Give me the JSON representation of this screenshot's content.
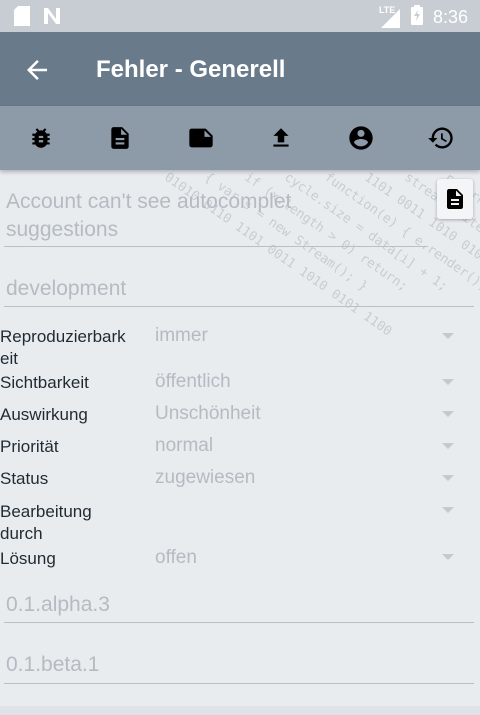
{
  "status_bar": {
    "time": "8:36",
    "network": "LTE",
    "left_icons": [
      "sd-card-icon",
      "n-notification-icon"
    ],
    "right_icons": [
      "signal-icon",
      "battery-icon"
    ]
  },
  "app_bar": {
    "title": "Fehler - Generell",
    "back_icon": "arrow-back-icon"
  },
  "toolbar": {
    "icons": [
      "bug-icon",
      "document-icon",
      "note-icon",
      "upload-icon",
      "account-icon",
      "history-icon"
    ]
  },
  "form": {
    "summary_line1": "Account can't see autocomplet",
    "summary_line2": "suggestions",
    "category": "development",
    "rows": [
      {
        "label_line1": "Reproduzierbark",
        "label_line2": "eit",
        "value": "immer"
      },
      {
        "label_line1": "Sichtbarkeit",
        "label_line2": "",
        "value": "öffentlich"
      },
      {
        "label_line1": "Auswirkung",
        "label_line2": "",
        "value": "Unschönheit"
      },
      {
        "label_line1": "Priorität",
        "label_line2": "",
        "value": "normal"
      },
      {
        "label_line1": "Status",
        "label_line2": "",
        "value": "zugewiesen"
      },
      {
        "label_line1": "Bearbeitung",
        "label_line2": "durch",
        "value": ""
      },
      {
        "label_line1": "Lösung",
        "label_line2": "",
        "value": "offen"
      }
    ],
    "version": "0.1.alpha.3",
    "target_version": "0.1.beta.1"
  }
}
